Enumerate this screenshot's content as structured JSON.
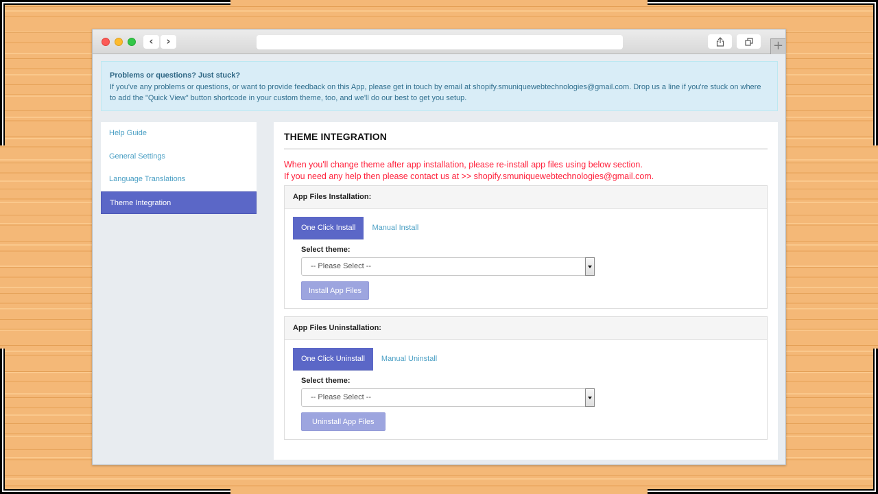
{
  "browser": {
    "nav_back_icon": "chevron-left-icon",
    "nav_forward_icon": "chevron-right-icon",
    "address_bar_value": "",
    "share_icon": "share-icon",
    "tabs_icon": "tabs-overview-icon",
    "new_tab_label": "+"
  },
  "alert": {
    "title": "Problems or questions? Just stuck?",
    "body": "If you've any problems or questions, or want to provide feedback on this App, please get in touch by email at shopify.smuniquewebtechnologies@gmail.com. Drop us a line if you're stuck on where to add the \"Quick View\" button shortcode in your custom theme, too, and we'll do our best to get you setup."
  },
  "sidebar": {
    "items": [
      {
        "label": "Help Guide",
        "active": false
      },
      {
        "label": "General Settings",
        "active": false
      },
      {
        "label": "Language Translations",
        "active": false
      },
      {
        "label": "Theme Integration",
        "active": true
      }
    ]
  },
  "main": {
    "title": "THEME INTEGRATION",
    "notice_line1": "When you'll change theme after app installation, please re-install app files using below section.",
    "notice_line2": "If you need any help then please contact us at >> shopify.smuniquewebtechnologies@gmail.com.",
    "install_panel": {
      "heading": "App Files Installation:",
      "tabs": [
        {
          "label": "One Click Install",
          "active": true
        },
        {
          "label": "Manual Install",
          "active": false
        }
      ],
      "select_label": "Select theme:",
      "select_value": "-- Please Select --",
      "button_label": "Install App Files"
    },
    "uninstall_panel": {
      "heading": "App Files Uninstallation:",
      "tabs": [
        {
          "label": "One Click Uninstall",
          "active": true
        },
        {
          "label": "Manual Uninstall",
          "active": false
        }
      ],
      "select_label": "Select theme:",
      "select_value": "-- Please Select --",
      "button_label": "Uninstall App Files"
    }
  },
  "colors": {
    "accent": "#5b67c7",
    "button_disabled": "#9da5df",
    "link": "#4a9fc4",
    "notice_red": "#ff1f3a",
    "alert_bg": "#d9edf7",
    "alert_text": "#31708f",
    "background_wood": "#f4b877"
  }
}
